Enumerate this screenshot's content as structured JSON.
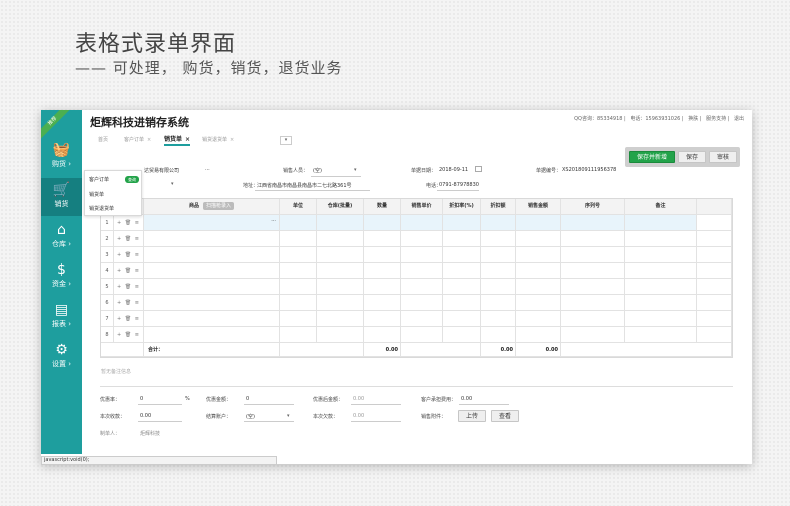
{
  "hero": {
    "title": "表格式录单界面",
    "subtitle": "—— 可处理， 购货，销货，退货业务"
  },
  "ribbon": "推荐",
  "app_title": "炬辉科技进销存系统",
  "top_links": [
    "QQ咨询：85334918",
    "电话：15963931026",
    "换肤",
    "服务支持",
    "退出"
  ],
  "sidebar": [
    {
      "label": "购货",
      "icon": "basket-icon",
      "glyph": "🧺"
    },
    {
      "label": "销货",
      "icon": "cart-icon",
      "glyph": "🛒"
    },
    {
      "label": "仓库",
      "icon": "warehouse-icon",
      "glyph": "⌂"
    },
    {
      "label": "资金",
      "icon": "dollar-icon",
      "glyph": "$"
    },
    {
      "label": "报表",
      "icon": "report-icon",
      "glyph": "▤"
    },
    {
      "label": "设置",
      "icon": "gear-icon",
      "glyph": "⚙"
    }
  ],
  "tabs": [
    {
      "label": "首页",
      "closable": false,
      "active": false
    },
    {
      "label": "客户订单",
      "closable": true,
      "active": false
    },
    {
      "label": "销货单",
      "closable": true,
      "active": true
    },
    {
      "label": "销货退货单",
      "closable": true,
      "active": false
    }
  ],
  "tab_add": "▾",
  "dropdown": {
    "items": [
      "客户订单",
      "销货单",
      "销货退货单"
    ],
    "badge": "查询"
  },
  "buttons": {
    "save_new": "保存并新增",
    "save": "保存",
    "audit": "审核"
  },
  "form": {
    "customer_value": "达贸易有限公司",
    "customer_more": "···",
    "salesperson_label": "销售人员：",
    "salesperson_value": "(空)",
    "date_label": "单据日期：",
    "date_value": "2018-09-11",
    "doc_no_label": "单据编号：",
    "doc_no_value": "XS201809111956378",
    "address_label": "地址：",
    "address_value": "江西省南昌市南昌县南昌市二七北路361号",
    "phone_label": "电话：",
    "phone_value": "0791-87978830"
  },
  "grid": {
    "columns": [
      {
        "label": ""
      },
      {
        "label": ""
      },
      {
        "label": "商品"
      },
      {
        "label": "单位"
      },
      {
        "label": "仓库(批量)"
      },
      {
        "label": "数量"
      },
      {
        "label": "销售单价"
      },
      {
        "label": "折扣率(%)"
      },
      {
        "label": "折扣额"
      },
      {
        "label": "销售金额"
      },
      {
        "label": "序列号"
      },
      {
        "label": "备注"
      },
      {
        "label": ""
      }
    ],
    "scan_tag": "扫描枪录入",
    "row_ops": "+ 🗑 ≡",
    "rows": [
      "1",
      "2",
      "3",
      "4",
      "5",
      "6",
      "7",
      "8"
    ],
    "first_row_more": "···",
    "total_label": "合计：",
    "total_qty": "0.00",
    "total_discount": "0.00",
    "total_amount": "0.00"
  },
  "remark_placeholder": "暂无备注信息",
  "footer": {
    "discount_rate_label": "优惠率：",
    "discount_rate_value": "0",
    "percent": "%",
    "discount_amount_label": "优惠金额：",
    "discount_amount_value": "0",
    "after_discount_label": "优惠后金额：",
    "after_discount_value": "0.00",
    "customer_fee_label": "客户承担费用：",
    "customer_fee_value": "0.00",
    "received_label": "本次收款：",
    "received_value": "0.00",
    "account_label": "结算账户：",
    "account_value": "(空)",
    "debt_label": "本次欠款：",
    "debt_value": "0.00",
    "attachment_label": "销售附件：",
    "upload_button": "上传",
    "view_button": "查看",
    "creator_label": "制单人：",
    "creator_value": "炬辉科技"
  },
  "status_bar": "javascript:void(0);"
}
